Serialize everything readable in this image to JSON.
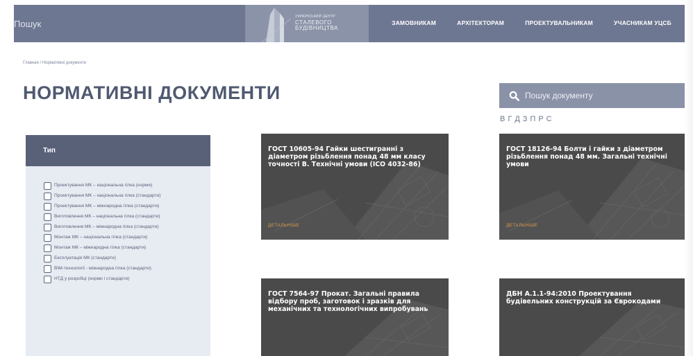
{
  "header": {
    "search_label": "Пошук",
    "logo": {
      "line1": "УКРАЇНСЬКИЙ ЦЕНТР",
      "line2": "СТАЛЕВОГО",
      "line3": "БУДІВНИЦТВА"
    },
    "nav": [
      "ЗАМОВНИКАМ",
      "АРХІТЕКТОРАМ",
      "ПРОЕКТУВАЛЬНИКАМ",
      "УЧАСНИКАМ УЦСБ"
    ]
  },
  "breadcrumb": "Главная / Нормативні документи",
  "page_title": "НОРМАТИВНІ ДОКУМЕНТИ",
  "doc_search": {
    "placeholder": "Пошук документу"
  },
  "letters": [
    "В",
    "Г",
    "Д",
    "З",
    "П",
    "Р",
    "С"
  ],
  "filter": {
    "title": "Тип",
    "options": [
      "Проектування МК – національна гілка (норми)",
      "Проектування МК – національна гілка (стандарти)",
      "Проектування МК – міжнародна гілка (стандарти)",
      "Виготовлення МК – національна гілка (стандарти)",
      "Виготовлення МК – міжнародна гілка (стандарти)",
      "Монтаж МК – національна гілка (стандарти)",
      "Монтаж МК – міжнародна гілка (стандарти)",
      "Експлуатація МК (стандарти)",
      "BIM-технології - міжнародна гілка (стандарти)",
      "НТД у розробці (норми і стандарти)"
    ]
  },
  "cards": [
    {
      "title": "ГОСТ 10605-94 Гайки шестигранні з діаметром різьблення понад 48 мм класу точності В. Технічні умови (ICO 4032-86)",
      "more": "ДЕТАЛЬНІШЕ"
    },
    {
      "title": "ГОСТ 18126-94 Болти і гайки з діаметром різьблення понад 48 мм. Загальні технічні умови",
      "more": "ДЕТАЛЬНІШЕ"
    },
    {
      "title": "ГОСТ 7564-97 Прокат. Загальні правила відбору проб, заготовок і зразків для механічних та технологічних випробувань",
      "more": ""
    },
    {
      "title": "ДБН А.1.1-94:2010 Проектування будівельних конструкцій за Єврокодами",
      "more": ""
    }
  ],
  "colors": {
    "header_bg": "#6e7791",
    "logo_bg": "#8b93a8",
    "filter_head": "#586178",
    "filter_bg": "#e7ebf2",
    "accent_link": "#d99a4a"
  }
}
